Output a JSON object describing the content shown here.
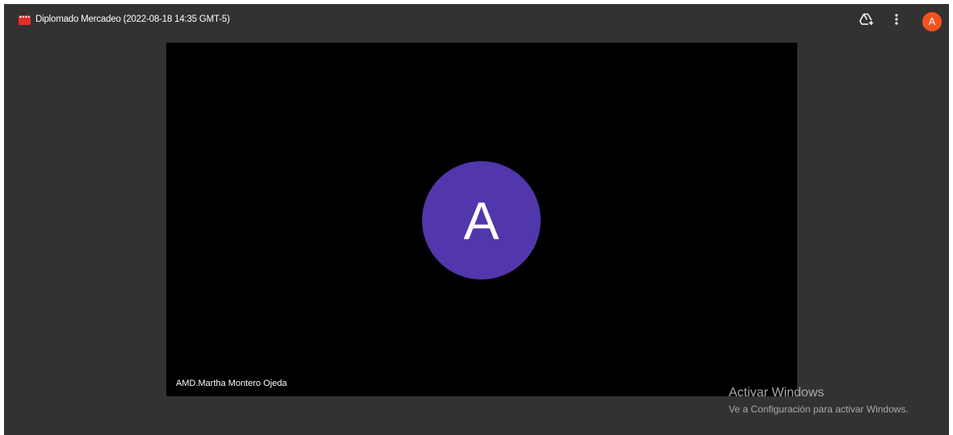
{
  "window": {
    "title": "Diplomado Mercadeo (2022-08-18 14:35 GMT-5)",
    "file_icon": "video-file-icon",
    "file_icon_color": "#e52d27"
  },
  "toolbar": {
    "drive_icon": "add-to-drive-icon",
    "more_icon": "more-vert-icon",
    "account_initial": "A",
    "account_color": "#f4511e"
  },
  "video": {
    "participant_initial": "A",
    "participant_color": "#5236ab",
    "participant_name": "AMD.Martha Montero Ojeda"
  },
  "watermark": {
    "title": "Activar Windows",
    "subtitle": "Ve a Configuración para activar Windows."
  }
}
